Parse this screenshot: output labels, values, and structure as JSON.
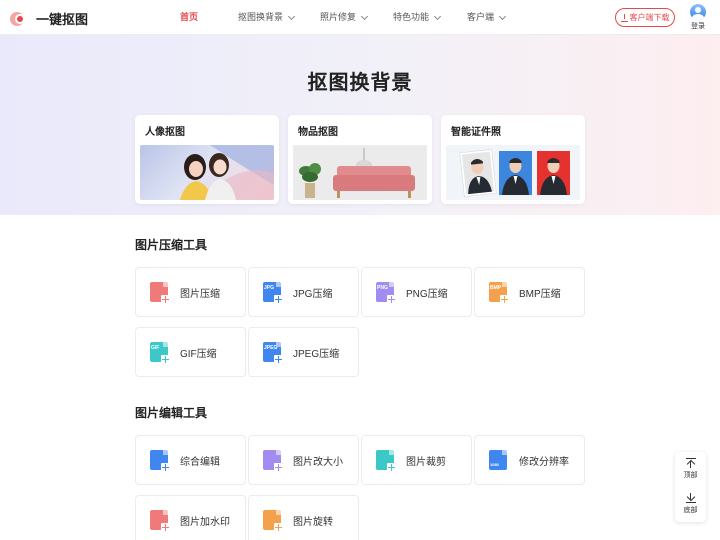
{
  "header": {
    "logo_text": "一键抠图",
    "nav": [
      {
        "label": "首页",
        "active": true
      },
      {
        "label": "抠图换背景"
      },
      {
        "label": "照片修复"
      },
      {
        "label": "特色功能"
      },
      {
        "label": "客户端"
      }
    ],
    "download_label": "客户端下载",
    "login_label": "登录"
  },
  "hero": {
    "title": "抠图换背景",
    "cards": [
      {
        "title": "人像抠图"
      },
      {
        "title": "物品抠图"
      },
      {
        "title": "智能证件照"
      }
    ]
  },
  "compress": {
    "title": "图片压缩工具",
    "tools": [
      {
        "label": "图片压缩",
        "icon": "image-compress-icon",
        "color": "#f07a7a"
      },
      {
        "label": "JPG压缩",
        "icon": "jpg-file-icon",
        "tag": "JPG",
        "color": "#3f86f0"
      },
      {
        "label": "PNG压缩",
        "icon": "png-file-icon",
        "tag": "PNG",
        "color": "#a38cf0"
      },
      {
        "label": "BMP压缩",
        "icon": "bmp-file-icon",
        "tag": "BMP",
        "color": "#f5a04d"
      },
      {
        "label": "GIF压缩",
        "icon": "gif-file-icon",
        "tag": "GIF",
        "color": "#3cc8c8"
      },
      {
        "label": "JPEG压缩",
        "icon": "jpeg-file-icon",
        "tag": "JPEG",
        "color": "#3f86f0"
      }
    ]
  },
  "edit": {
    "title": "图片编辑工具",
    "tools": [
      {
        "label": "综合编辑",
        "icon": "edit-image-icon",
        "color": "#3f86f0"
      },
      {
        "label": "图片改大小",
        "icon": "resize-image-icon",
        "color": "#a38cf0"
      },
      {
        "label": "图片裁剪",
        "icon": "crop-image-icon",
        "color": "#3cc8c8"
      },
      {
        "label": "修改分辨率",
        "icon": "resolution-icon",
        "tag": "1080",
        "color": "#3f86f0"
      },
      {
        "label": "图片加水印",
        "icon": "watermark-icon",
        "color": "#f07a7a"
      },
      {
        "label": "图片旋转",
        "icon": "rotate-image-icon",
        "color": "#f5a04d"
      }
    ]
  },
  "float": {
    "top_label": "顶部",
    "bottom_label": "底部"
  }
}
